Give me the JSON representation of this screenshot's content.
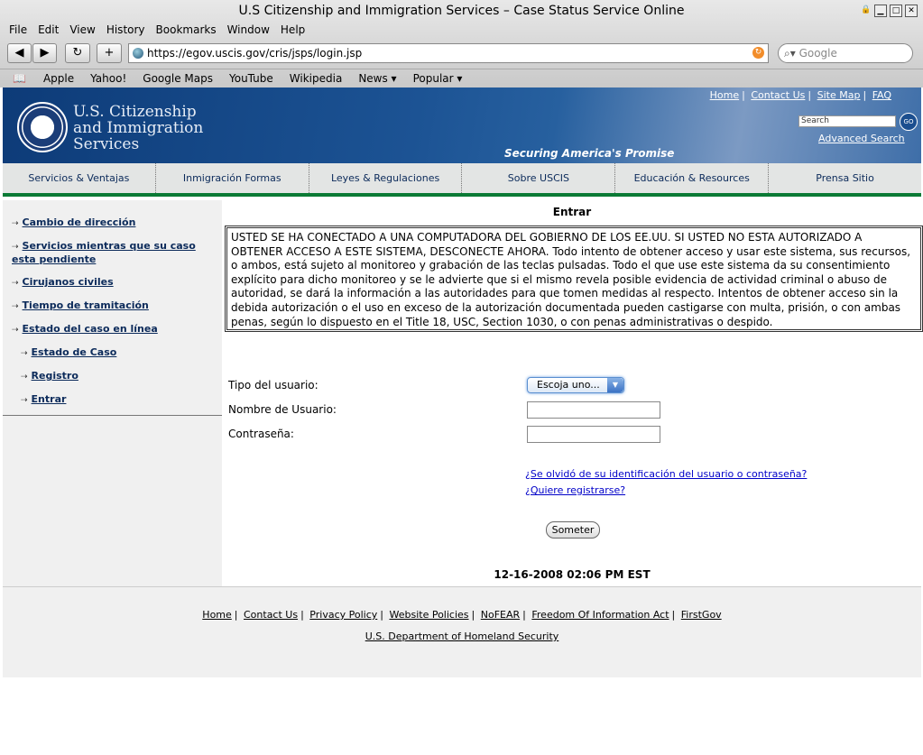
{
  "window": {
    "title": "U.S Citizenship and Immigration Services – Case Status Service Online"
  },
  "menu": [
    "File",
    "Edit",
    "View",
    "History",
    "Bookmarks",
    "Window",
    "Help"
  ],
  "toolbar": {
    "back": "◀",
    "forward": "▶",
    "reload": "↻",
    "add": "+",
    "url": "https://egov.uscis.gov/cris/jsps/login.jsp",
    "search_placeholder": "Google"
  },
  "bookmarks": [
    "Apple",
    "Yahoo!",
    "Google Maps",
    "YouTube",
    "Wikipedia",
    "News ▾",
    "Popular ▾"
  ],
  "header": {
    "agency_line1": "U.S. Citizenship",
    "agency_line2": "and Immigration",
    "agency_line3": "Services",
    "slogan": "Securing America's Promise",
    "top_links": [
      "Home",
      "Contact Us",
      "Site Map",
      "FAQ"
    ],
    "search_placeholder": "Search",
    "go": "GO",
    "advanced_search": "Advanced Search"
  },
  "tabs": [
    "Servicios & Ventajas",
    "Inmigración Formas",
    "Leyes & Regulaciones",
    "Sobre USCIS",
    "Educación & Resources",
    "Prensa Sitio"
  ],
  "sidebar": [
    {
      "label": "Cambio de dirección"
    },
    {
      "label": "Servicios mientras que su caso esta pendiente"
    },
    {
      "label": "Cirujanos civiles"
    },
    {
      "label": "Tiempo de tramitación"
    },
    {
      "label": "Estado del caso en línea"
    },
    {
      "label": "Estado de Caso"
    },
    {
      "label": "Registro"
    },
    {
      "label": "Entrar"
    }
  ],
  "main": {
    "heading": "Entrar",
    "warning": "USTED SE HA CONECTADO A UNA COMPUTADORA DEL GOBIERNO DE LOS EE.UU. SI USTED NO ESTA AUTORIZADO A OBTENER ACCESO A ESTE SISTEMA, DESCONECTE AHORA. Todo intento de obtener acceso y usar este sistema, sus recursos, o ambos, está sujeto al monitoreo y grabación de las teclas pulsadas. Todo el que use este sistema da su consentimiento explícito para dicho monitoreo y se le advierte que si el mismo revela posible evidencia de actividad criminal o abuso de autoridad, se dará la información a las autoridades para que tomen medidas al respecto. Intentos de obtener acceso sin la debida autorización o el uso en exceso de la autorización documentada pueden castigarse con multa, prisión, o con ambas penas, según lo dispuesto en el Title 18, USC, Section 1030, o con penas administrativas o despido.",
    "user_type_label": "Tipo del usuario:",
    "user_type_value": "Escoja uno...",
    "username_label": "Nombre de Usuario:",
    "username_value": "",
    "password_label": "Contraseña:",
    "password_value": "",
    "forgot_link": "¿Se olvidó de su identificación del usuario o contraseña?",
    "register_link": "¿Quiere registrarse?",
    "submit": "Someter",
    "datetime": "12-16-2008 02:06 PM EST"
  },
  "footer": {
    "links": [
      "Home",
      "Contact Us",
      "Privacy Policy",
      "Website Policies",
      "NoFEAR",
      "Freedom Of Information Act",
      "FirstGov"
    ],
    "dhs": "U.S. Department of Homeland Security"
  }
}
